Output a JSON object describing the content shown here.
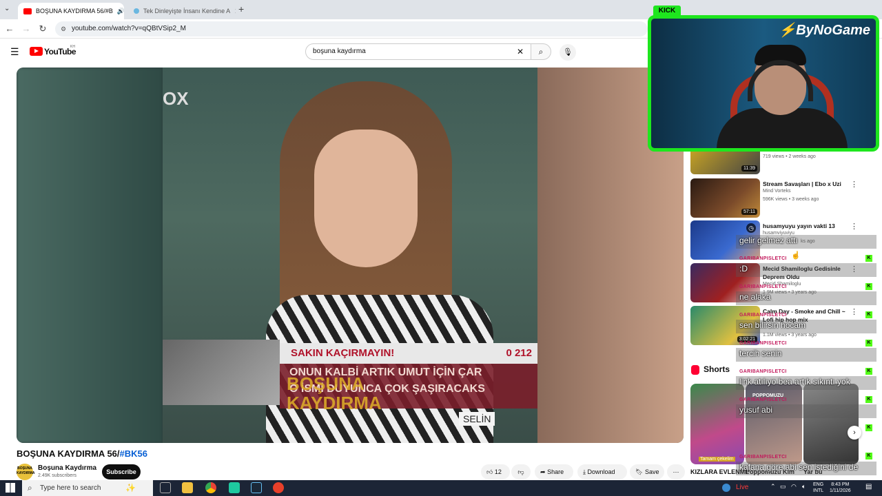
{
  "browser": {
    "tabs": [
      {
        "title": "BOŞUNA KAYDIRMA 56/#B",
        "active": true
      },
      {
        "title": "Tek Dinleyişte İnsanı Kendine A",
        "active": false
      }
    ],
    "url": "youtube.com/watch?v=qQBtVSip2_M"
  },
  "youtube": {
    "logo_text": "YouTube",
    "logo_region": "KH",
    "search_value": "boşuna kaydırma"
  },
  "video": {
    "overlay_logo": "OX",
    "banner_top": "SAKIN KAÇIRMAYIN!",
    "banner_number": "0 212",
    "banner_line1": "ONUN KALBİ ARTIK UMUT İÇİN ÇAR",
    "banner_line2": "O İSMİ DUYUNCA ÇOK ŞAŞIRACAKS",
    "show_logo_line1": "BOŞUNA",
    "show_logo_line2": "KAYDIRMA",
    "name_card": "SELİN",
    "title_main": "BOŞUNA KAYDIRMA 56/",
    "title_tag": "#BK56",
    "channel_name": "Boşuna Kaydırma",
    "channel_subscribers": "2.49K subscribers",
    "channel_avatar_text": "BOŞUNA KAYDIRMA",
    "subscribe_label": "Subscribe",
    "like_count": "12",
    "share_label": "Share",
    "download_label": "Download",
    "save_label": "Save"
  },
  "sidebar": {
    "items": [
      {
        "title": "",
        "channel": "",
        "meta": "719 views • 2 weeks ago",
        "duration": "11:39"
      },
      {
        "title": "Stream Savaşları | Ebo x Uzi",
        "channel": "Mind Vorteks",
        "meta": "596K views • 3 weeks ago",
        "duration": "57:11"
      },
      {
        "title": "husamyuyu yayın vakti 13",
        "channel": "husamviyuviyu",
        "meta": "ks ago",
        "duration": ""
      },
      {
        "title": "Mecid Shamiloglu Gedisinle Deprem Oldu",
        "channel": "Mecid Shamiloglu",
        "meta": "1.9M views • 3 years ago",
        "duration": ""
      },
      {
        "title": "Calm Day - Smoke and Chill ~ Lofi hip hop mix",
        "channel": "",
        "meta": "1.1M views • 3 years ago",
        "duration": "3:02:21"
      }
    ],
    "shorts_label": "Shorts",
    "shorts": [
      {
        "caption": "Tamam çekelim",
        "title": "KIZLARA EVLENME"
      },
      {
        "caption": "POPPOMUZU",
        "title": "Poppomuzu Kim"
      },
      {
        "caption": "",
        "title": "Yar bu"
      }
    ]
  },
  "stream": {
    "platform": "KICK",
    "brand": "ByNoGame",
    "chat": [
      {
        "user": "",
        "message": "gelir gelmez attı"
      },
      {
        "user": "GARIBANPISLETCI",
        "message": ":D"
      },
      {
        "user": "GARIBANPISLETCI",
        "message": "ne alaka"
      },
      {
        "user": "GARIBANPISLETCI",
        "message": "sen bilirsin hocam"
      },
      {
        "user": "GARIBANPISLETCI",
        "message": "tercih senin"
      },
      {
        "user": "GARIBANPISLETCI",
        "message": "link atılıyo bea artık sıkıntı yok"
      },
      {
        "user": "GARIBANPISLETCI",
        "message": "yusuf abi"
      },
      {
        "user": "GARIBANPISLETCI",
        "message": "kafana göre abi sen istediğini de"
      }
    ]
  },
  "taskbar": {
    "search_placeholder": "Type here to search",
    "live_label": "Live",
    "lang_top": "ENG",
    "lang_bottom": "INTL",
    "time": "8:43 PM",
    "date": "1/11/2026"
  },
  "colors": {
    "kick_green": "#53fc18",
    "youtube_red": "#ff0000",
    "chat_user": "#c2185b"
  }
}
